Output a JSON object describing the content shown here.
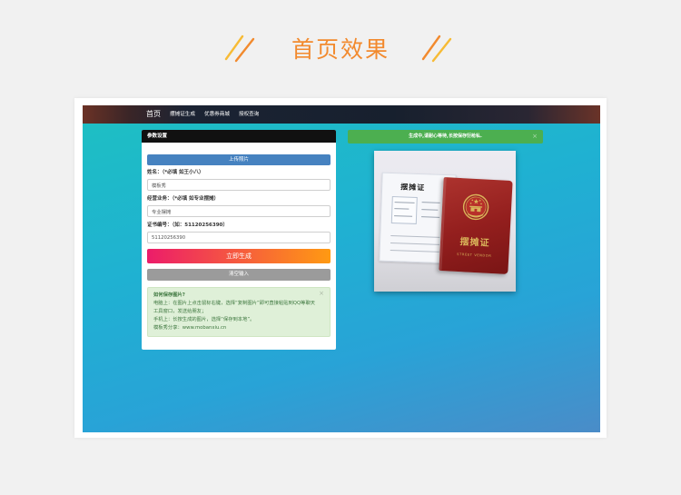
{
  "heading": {
    "title": "首页效果"
  },
  "colors": {
    "accent": "#f28a2e",
    "accent_light": "#f7bb35",
    "page_bg": "#f1f1f1",
    "primary": "#4682c0",
    "success": "#4caf50",
    "generate_start": "#ec1c6a",
    "generate_end": "#ff9a12",
    "neutral": "#9b9b9b",
    "panel_header": "#111111",
    "alert_bg": "#dff0d8",
    "alert_border": "#cfe6c3",
    "alert_text": "#3c763d",
    "screen_start": "#1ec0c2",
    "screen_end": "#4a8cc8",
    "booklet": "#941f1e",
    "gold": "#d9b45a"
  },
  "icons": {
    "decoration": "slash-decoration-icon",
    "close": "close-icon",
    "emblem": "emblem-icon"
  },
  "preview": {
    "nav": {
      "items": [
        "首页",
        "摆摊证生成",
        "优惠券商城",
        "授权查询"
      ]
    },
    "form": {
      "header": "参数设置",
      "upload_label": "上传照片",
      "fields": [
        {
          "label": "姓名：（*必填 如王小八）",
          "value": "模板秀"
        },
        {
          "label": "经营业务：（*必填 如专业摆摊）",
          "value": "专业摆摊"
        },
        {
          "label": "证书编号：（如：51120256390）",
          "value": "51120256390"
        }
      ],
      "generate_label": "立即生成",
      "clear_label": "清空输入",
      "tip": {
        "title": "如何保存图片?",
        "lines": [
          "电脑上：在图片上点击鼠标右键，选择“复制图片”即可直接粘贴到QQ等聊天工具窗口，发送给朋友；",
          "手机上：长按生成的图片，选择“保存到本地”。",
          "模板秀分享：www.mobanxiu.cn"
        ],
        "close": "×"
      }
    },
    "status": {
      "message": "生成中,请耐心等待,长按保存衍枪私.",
      "close": "×"
    },
    "certificate": {
      "card_title": "摆摊证",
      "booklet_title": "摆摊证",
      "booklet_subtitle": "STREET VENDOR"
    }
  }
}
